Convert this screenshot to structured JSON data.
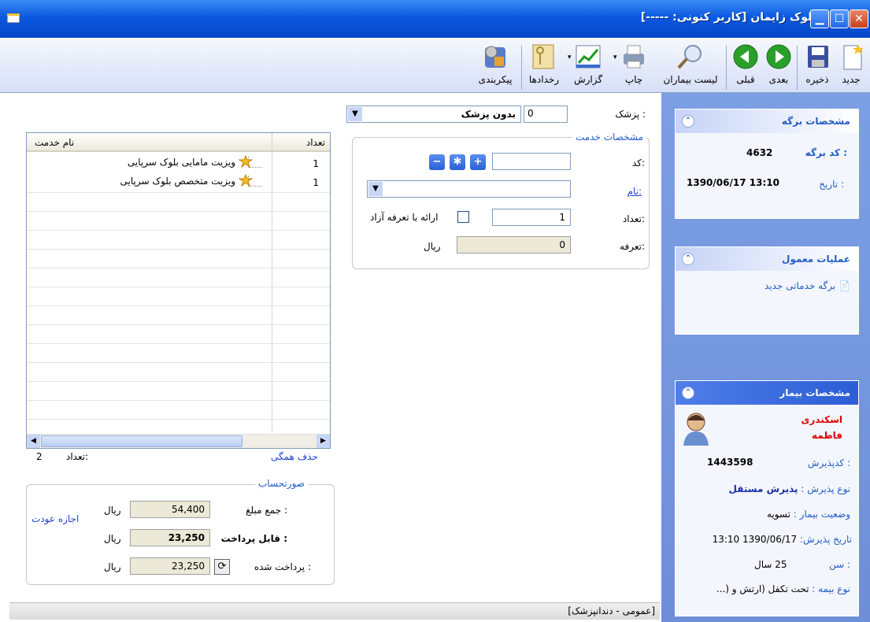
{
  "window": {
    "title": "بلوک زایمان [کاربر کنونی: -----]"
  },
  "toolbar": {
    "items": [
      {
        "label": "جدید",
        "icon": "new-icon"
      },
      {
        "label": "ذخیره",
        "icon": "save-icon"
      },
      {
        "label": "بعدی",
        "icon": "next-icon"
      },
      {
        "label": "قبلی",
        "icon": "previous-icon"
      },
      {
        "label": "لیست بیماران",
        "icon": "search-icon"
      },
      {
        "label": "چاپ",
        "icon": "print-icon"
      },
      {
        "label": "گزارش",
        "icon": "report-icon"
      },
      {
        "label": "رخدادها",
        "icon": "events-icon"
      },
      {
        "label": "پیکربندی",
        "icon": "config-icon"
      }
    ]
  },
  "doctor": {
    "label": "پزشک :",
    "code": "0",
    "name": "بدون پزشک"
  },
  "service_spec": {
    "legend": "مشخصات خدمت",
    "code_label": "کد:",
    "name_label": "نام:",
    "count_label": "تعداد:",
    "count_value": "1",
    "free_tariff_label": "ارائه با تعرفه آزاد",
    "tariff_label": "تعرفه:",
    "tariff_value": "0",
    "currency": "ریال"
  },
  "service_table": {
    "columns": [
      "تعداد",
      "نام خدمت"
    ],
    "rows": [
      {
        "count": "1",
        "name": "ویزیت مامایی بلوک سرپایی"
      },
      {
        "count": "1",
        "name": "ویزیت متخصص بلوک سرپایی"
      }
    ]
  },
  "table_footer": {
    "count_label": "تعداد:",
    "count_value": "2",
    "delete_all": "حذف همگی"
  },
  "invoice": {
    "legend": "صورتحساب",
    "total_label": "جمع مبلغ :",
    "total_value": "54,400",
    "payable_label": "قابل پرداخت :",
    "payable_value": "23,250",
    "paid_label": "پرداخت شده :",
    "paid_value": "23,250",
    "currency": "ریال",
    "return_permit": "اجازه عودت"
  },
  "sheet_panel": {
    "title": "مشخصات برگه",
    "code_label": "کد برگه :",
    "code_value": "4632",
    "date_label": "تاریخ :",
    "date_value": "1390/06/17 13:10"
  },
  "ops_panel": {
    "title": "عملیات معمول",
    "new_sheet": "برگه خدماتی جدید"
  },
  "patient_panel": {
    "title": "مشخصات بیمار",
    "last_name": "اسکندری",
    "first_name": "فاطمه",
    "admit_code_label": "کدپذیرش :",
    "admit_code_value": "1443598",
    "admit_type_label": "نوع پذیرش :",
    "admit_type_value": "پذیرش مستقل",
    "status_label": "وضعیت بیمار :",
    "status_value": "تسویه",
    "admit_date_label": "تاریخ پذیرش:",
    "admit_date_value": "1390/06/17 13:10",
    "age_label": "سن :",
    "age_value": "25 سال",
    "insurance_label": "نوع بیمه :",
    "insurance_value": "تحت تکفل (ارتش و (..."
  },
  "status": {
    "text": "[عمومی - دندانپزشک]"
  },
  "colors": {
    "title_blue": "#0a58e0",
    "panel_link": "#215dc6",
    "patient_name": "#e00000"
  }
}
